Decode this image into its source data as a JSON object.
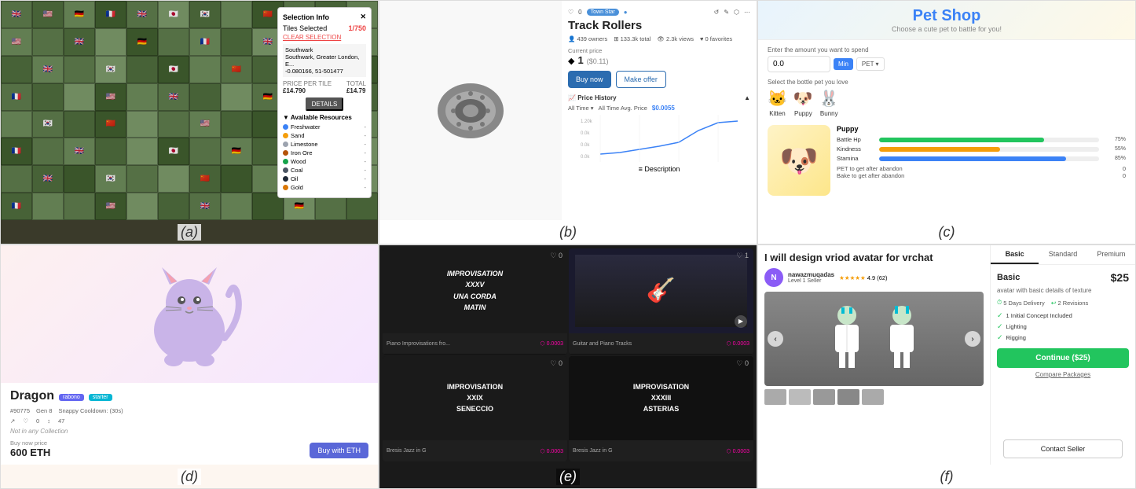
{
  "panels": {
    "a": {
      "label": "(a)",
      "overlay": {
        "title": "Selection Info",
        "tiles_label": "Tiles Selected",
        "tiles_count": "1/750",
        "clear_btn": "CLEAR SELECTION",
        "location": "Southwark",
        "sublocation": "Southwark, Greater London, E...",
        "coords": "-0.080166, 51-501477",
        "price_per_tile_label": "PRICE PER TILE",
        "price_per_tile": "£14.790",
        "total_label": "TOTAL",
        "total_price": "£14.79",
        "details_btn": "DETAILS",
        "resources_title": "▼ Available Resources",
        "resources": [
          {
            "name": "Freshwater",
            "color": "#3b82f6"
          },
          {
            "name": "Sand",
            "color": "#f59e0b"
          },
          {
            "name": "Limestone",
            "color": "#9ca3af"
          },
          {
            "name": "Iron Ore",
            "color": "#b45309"
          },
          {
            "name": "Wood",
            "color": "#16a34a"
          },
          {
            "name": "Coal",
            "color": "#4b5563"
          },
          {
            "name": "Oil",
            "color": "#1f2937"
          },
          {
            "name": "Gold",
            "color": "#d97706"
          }
        ]
      }
    },
    "b": {
      "label": "(b)",
      "topbar": {
        "heart": "♡",
        "count": "0",
        "town_star": "Town Star",
        "icons": [
          "↺",
          "✎",
          "⬡",
          "⋯"
        ]
      },
      "title": "Track Rollers",
      "meta": {
        "owners": "439 owners",
        "total": "133.3k total",
        "views": "2.3k views",
        "favorites": "0 favorites"
      },
      "current_price_label": "Current price",
      "price": "1",
      "price_usd": "($0.11)",
      "buy_btn": "Buy now",
      "offer_btn": "Make offer",
      "price_history_label": "Price History",
      "time_options": [
        "All Time",
        "All Time Avg. Price"
      ],
      "avg_price": "$0.0055",
      "description_label": "Description"
    },
    "c": {
      "label": "(c)",
      "header": {
        "title": "Pet Shop",
        "subtitle": "Choose a cute pet to battle for you!"
      },
      "amount_label": "Enter the amount you want to spend",
      "amount_value": "0.0",
      "min_btn": "Min",
      "pet_btn": "PET ▾",
      "select_label": "Select the bottle pet you love",
      "pets": [
        {
          "name": "Kitten",
          "emoji": "🐱"
        },
        {
          "name": "Puppy",
          "emoji": "🐶"
        },
        {
          "name": "Bunny",
          "emoji": "🐰"
        }
      ],
      "selected_pet": "Puppy",
      "pet_emoji": "🐶",
      "stats": [
        {
          "label": "Battle Hp",
          "pct": 75,
          "color": "#22c55e"
        },
        {
          "label": "Kindness",
          "pct": 55,
          "color": "#f59e0b"
        },
        {
          "label": "Stamina",
          "pct": 85,
          "color": "#3b82f6"
        }
      ],
      "adopt": {
        "pet_label": "PET to get after abandon",
        "bake_label": "Bake to get after abandon",
        "pet_count": "0",
        "bake_count": "0"
      }
    },
    "d": {
      "label": "(d)",
      "name": "Dragon",
      "id": "#90775",
      "gen": "Gen 8",
      "cooldown": "Snappy Cooldown: (30s)",
      "stats": {
        "heart": "♡",
        "heart_count": "0",
        "arrows": "↕",
        "count": "47"
      },
      "collection_note": "Not in any Collection",
      "buy_label": "Buy now price",
      "price": "600 ETH",
      "buy_btn": "Buy with ETH",
      "badge1": "rabono",
      "badge2": "starter"
    },
    "e": {
      "label": "(e)",
      "cards": [
        {
          "title": "IMPROVISATION\nXXXV\nUNA CORDA\nMATIN",
          "type": "text",
          "bg": "#222",
          "likes": "0",
          "heart": "♡",
          "price": "0.0003"
        },
        {
          "title": "guitar_player",
          "type": "photo",
          "bg": "#2a2a3e",
          "likes": "1",
          "heart": "♡",
          "price": "0.0003"
        },
        {
          "title": "IMPROVISATION\nXXIX\nSENECCIO",
          "type": "text",
          "bg": "#1a1a1a",
          "likes": "0",
          "heart": "♡",
          "price": "0.0003"
        },
        {
          "title": "IMPROVISATION\nXXXIII\nASTERIAS",
          "type": "text",
          "bg": "#111",
          "likes": "0",
          "heart": "♡",
          "price": "0.0003"
        }
      ],
      "top_labels": [
        "Piano Improvisations fro...",
        "Guitar and Piano Tracks"
      ]
    },
    "f": {
      "label": "(f)",
      "gig_title": "I will design vriod avatar for vrchat",
      "seller": {
        "name": "nawazmuqadas",
        "level": "Level 1 Seller",
        "rating": "4.9",
        "reviews": "62"
      },
      "package_tabs": [
        "Basic",
        "Standard",
        "Premium"
      ],
      "active_tab": "Basic",
      "package": {
        "name": "Basic",
        "price": "$25",
        "desc": "avatar with basic details of texture",
        "delivery": "5 Days Delivery",
        "revisions": "2 Revisions",
        "features": [
          "1 Initial Concept Included",
          "Lighting",
          "Rigging"
        ]
      },
      "continue_btn": "Continue ($25)",
      "compare_link": "Compare Packages",
      "contact_btn": "Contact Seller"
    }
  }
}
